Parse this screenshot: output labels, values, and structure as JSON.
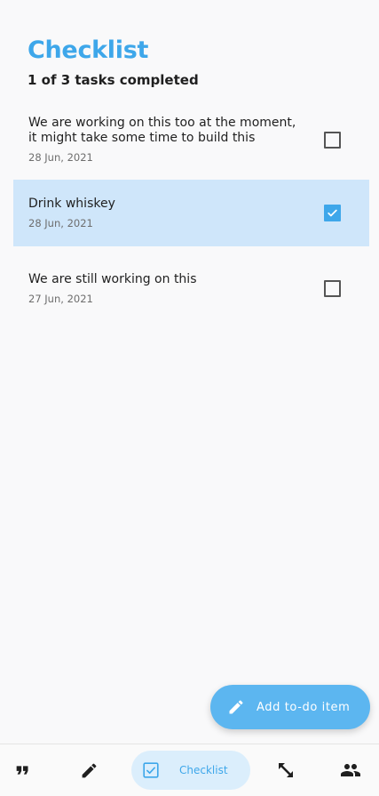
{
  "header": {
    "title": "Checklist",
    "subtitle": "1 of 3 tasks completed"
  },
  "tasks": [
    {
      "label_line1": "We are working on this too at the moment,",
      "label_line2": "it might take some time to build this",
      "date": "28 Jun, 2021",
      "checked": false
    },
    {
      "label_line1": "Drink whiskey",
      "date": "28 Jun, 2021",
      "checked": true
    },
    {
      "label_line1": "We are still working on this",
      "date": "27 Jun, 2021",
      "checked": false
    }
  ],
  "fab": {
    "label": "Add to-do item",
    "icon": "pencil-icon"
  },
  "bottom_nav": {
    "items": [
      {
        "icon": "quote-icon"
      },
      {
        "icon": "pencil-icon"
      },
      {
        "icon": "checklist-icon",
        "label": "Checklist",
        "active": true
      },
      {
        "icon": "expand-arrows-icon"
      },
      {
        "icon": "people-icon"
      }
    ]
  },
  "colors": {
    "accent": "#3ea7ea",
    "selected_row": "#cfe6fa",
    "fab": "#5cb6f0"
  }
}
